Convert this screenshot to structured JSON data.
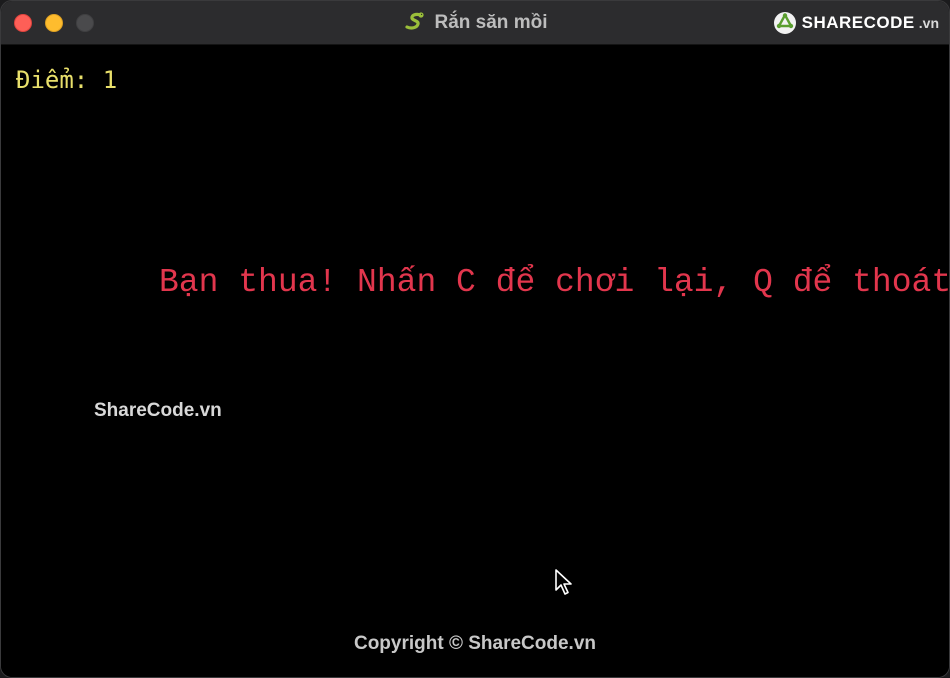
{
  "window": {
    "title": "Rắn săn mồi",
    "title_icon": "snake-icon"
  },
  "watermark": {
    "logo_main": "SHARECODE",
    "logo_suffix": ".vn",
    "middle_text": "ShareCode.vn",
    "copyright": "Copyright © ShareCode.vn"
  },
  "game": {
    "score_text": "Điểm: 1",
    "message": "Bạn thua! Nhấn C để chơi lại, Q để thoát"
  },
  "colors": {
    "score": "#e9e06b",
    "message": "#e2364d",
    "background": "#000000"
  }
}
